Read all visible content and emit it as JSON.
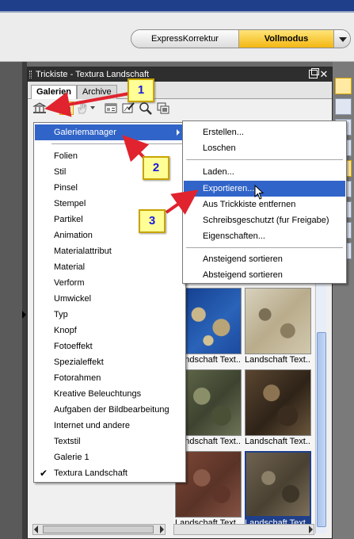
{
  "modebar": {
    "express_label": "ExpressKorrektur",
    "voll_label": "Vollmodus"
  },
  "palette": {
    "title": "Trickiste - Textura Landschaft",
    "close_glyph": "✕"
  },
  "tabs": [
    {
      "label": "Galerien"
    },
    {
      "label": "Archive"
    }
  ],
  "menu1": {
    "items": [
      {
        "label": "Galeriemanager"
      },
      {
        "label": "Folien"
      },
      {
        "label": "Stil"
      },
      {
        "label": "Pinsel"
      },
      {
        "label": "Stempel"
      },
      {
        "label": "Partikel"
      },
      {
        "label": "Animation"
      },
      {
        "label": "Materialattribut"
      },
      {
        "label": "Material"
      },
      {
        "label": "Verform"
      },
      {
        "label": "Umwickel"
      },
      {
        "label": "Typ"
      },
      {
        "label": "Knopf"
      },
      {
        "label": "Fotoeffekt"
      },
      {
        "label": "Spezialeffekt"
      },
      {
        "label": "Fotorahmen"
      },
      {
        "label": "Kreative Beleuchtungs"
      },
      {
        "label": "Aufgaben der Bildbearbeitung"
      },
      {
        "label": "Internet und andere"
      },
      {
        "label": "Textstil"
      },
      {
        "label": "Galerie 1"
      },
      {
        "label": "Textura Landschaft"
      }
    ],
    "check_glyph": "✔"
  },
  "menu2": {
    "items": [
      {
        "label": "Erstellen..."
      },
      {
        "label": "Loschen"
      },
      {
        "label": "Laden..."
      },
      {
        "label": "Exportieren..."
      },
      {
        "label": "Aus Trickkiste entfernen"
      },
      {
        "label": "Schreibsgeschutzt (fur Freigabe)"
      },
      {
        "label": "Eigenschaften..."
      },
      {
        "label": "Ansteigend sortieren"
      },
      {
        "label": "Absteigend sortieren"
      }
    ]
  },
  "gallery": {
    "captions": [
      "Landschaft Text...",
      "Landschaft Text...",
      "Landschaft Text...",
      "Landschaft Text...",
      "Landschaft Text...",
      "Landschaft Text..."
    ]
  },
  "callouts": [
    {
      "label": "1"
    },
    {
      "label": "2"
    },
    {
      "label": "3"
    }
  ],
  "colors": {
    "highlight": "#3164c8",
    "callout_fill": "#ffff96",
    "arrow": "#e0232e",
    "vollmodus": "#f7c232"
  }
}
